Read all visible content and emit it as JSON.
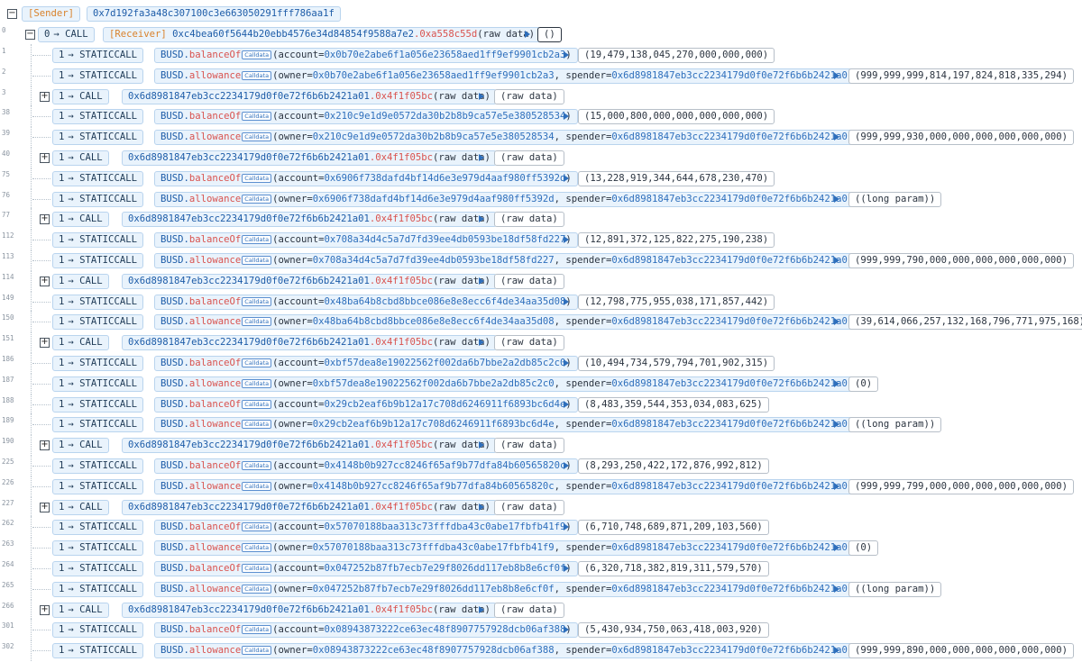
{
  "header": {
    "sender_label": "[Sender]",
    "sender_address": "0x7d192fa3a48c307100c3e663050291fff786aa1f"
  },
  "root_call": {
    "line": "0",
    "depth": "0",
    "op": "CALL",
    "receiver_label": "[Receiver]",
    "address": "0xc4bea60f5644b20ebb4576e34d84854f9588a7e2",
    "selector": ".0xa558c55d",
    "args": "(raw data)",
    "result": "()"
  },
  "calldata_badge": "Calldata",
  "rows": [
    {
      "line": "1",
      "depth": "1",
      "op": "STATICCALL",
      "contract": "BUSD.",
      "func": "balanceOf",
      "args_before": "(account=",
      "arg1": "0x0b70e2abe6f1a056e23658aed1ff9ef9901cb2a3",
      "mid": "",
      "arg2": "",
      "tail": ")",
      "result": "(19,479,138,045,270,000,000,000)"
    },
    {
      "line": "2",
      "depth": "1",
      "op": "STATICCALL",
      "contract": "BUSD.",
      "func": "allowance",
      "args_before": "(owner=",
      "arg1": "0x0b70e2abe6f1a056e23658aed1ff9ef9901cb2a3",
      "mid": ", spender=",
      "arg2": "0x6d8981847eb3cc2234179d0f0e72f6b6b2421a01",
      "tail": ")",
      "result": "(999,999,999,814,197,824,818,335,294)"
    },
    {
      "line": "3",
      "depth": "1",
      "op": "CALL",
      "collapsed": true,
      "address": "0x6d8981847eb3cc2234179d0f0e72f6b6b2421a01",
      "selector": ".0x4f1f05bc",
      "args": "(raw data)",
      "result": "(raw data)"
    },
    {
      "line": "38",
      "depth": "1",
      "op": "STATICCALL",
      "contract": "BUSD.",
      "func": "balanceOf",
      "args_before": "(account=",
      "arg1": "0x210c9e1d9e0572da30b2b8b9ca57e5e380528534",
      "mid": "",
      "arg2": "",
      "tail": ")",
      "result": "(15,000,800,000,000,000,000,000)"
    },
    {
      "line": "39",
      "depth": "1",
      "op": "STATICCALL",
      "contract": "BUSD.",
      "func": "allowance",
      "args_before": "(owner=",
      "arg1": "0x210c9e1d9e0572da30b2b8b9ca57e5e380528534",
      "mid": ", spender=",
      "arg2": "0x6d8981847eb3cc2234179d0f0e72f6b6b2421a01",
      "tail": ")",
      "result": "(999,999,930,000,000,000,000,000,000)"
    },
    {
      "line": "40",
      "depth": "1",
      "op": "CALL",
      "collapsed": true,
      "address": "0x6d8981847eb3cc2234179d0f0e72f6b6b2421a01",
      "selector": ".0x4f1f05bc",
      "args": "(raw data)",
      "result": "(raw data)"
    },
    {
      "line": "75",
      "depth": "1",
      "op": "STATICCALL",
      "contract": "BUSD.",
      "func": "balanceOf",
      "args_before": "(account=",
      "arg1": "0x6906f738dafd4bf14d6e3e979d4aaf980ff5392d",
      "mid": "",
      "arg2": "",
      "tail": ")",
      "result": "(13,228,919,344,644,678,230,470)"
    },
    {
      "line": "76",
      "depth": "1",
      "op": "STATICCALL",
      "contract": "BUSD.",
      "func": "allowance",
      "args_before": "(owner=",
      "arg1": "0x6906f738dafd4bf14d6e3e979d4aaf980ff5392d",
      "mid": ", spender=",
      "arg2": "0x6d8981847eb3cc2234179d0f0e72f6b6b2421a01",
      "tail": ")",
      "result": "((long param))"
    },
    {
      "line": "77",
      "depth": "1",
      "op": "CALL",
      "collapsed": true,
      "address": "0x6d8981847eb3cc2234179d0f0e72f6b6b2421a01",
      "selector": ".0x4f1f05bc",
      "args": "(raw data)",
      "result": "(raw data)"
    },
    {
      "line": "112",
      "depth": "1",
      "op": "STATICCALL",
      "contract": "BUSD.",
      "func": "balanceOf",
      "args_before": "(account=",
      "arg1": "0x708a34d4c5a7d7fd39ee4db0593be18df58fd227",
      "mid": "",
      "arg2": "",
      "tail": ")",
      "result": "(12,891,372,125,822,275,190,238)"
    },
    {
      "line": "113",
      "depth": "1",
      "op": "STATICCALL",
      "contract": "BUSD.",
      "func": "allowance",
      "args_before": "(owner=",
      "arg1": "0x708a34d4c5a7d7fd39ee4db0593be18df58fd227",
      "mid": ", spender=",
      "arg2": "0x6d8981847eb3cc2234179d0f0e72f6b6b2421a01",
      "tail": ")",
      "result": "(999,999,790,000,000,000,000,000,000)"
    },
    {
      "line": "114",
      "depth": "1",
      "op": "CALL",
      "collapsed": true,
      "address": "0x6d8981847eb3cc2234179d0f0e72f6b6b2421a01",
      "selector": ".0x4f1f05bc",
      "args": "(raw data)",
      "result": "(raw data)"
    },
    {
      "line": "149",
      "depth": "1",
      "op": "STATICCALL",
      "contract": "BUSD.",
      "func": "balanceOf",
      "args_before": "(account=",
      "arg1": "0x48ba64b8cbd8bbce086e8e8ecc6f4de34aa35d08",
      "mid": "",
      "arg2": "",
      "tail": ")",
      "result": "(12,798,775,955,038,171,857,442)"
    },
    {
      "line": "150",
      "depth": "1",
      "op": "STATICCALL",
      "contract": "BUSD.",
      "func": "allowance",
      "args_before": "(owner=",
      "arg1": "0x48ba64b8cbd8bbce086e8e8ecc6f4de34aa35d08",
      "mid": ", spender=",
      "arg2": "0x6d8981847eb3cc2234179d0f0e72f6b6b2421a01",
      "tail": ")",
      "result": "(39,614,066,257,132,168,796,771,975,168)"
    },
    {
      "line": "151",
      "depth": "1",
      "op": "CALL",
      "collapsed": true,
      "address": "0x6d8981847eb3cc2234179d0f0e72f6b6b2421a01",
      "selector": ".0x4f1f05bc",
      "args": "(raw data)",
      "result": "(raw data)"
    },
    {
      "line": "186",
      "depth": "1",
      "op": "STATICCALL",
      "contract": "BUSD.",
      "func": "balanceOf",
      "args_before": "(account=",
      "arg1": "0xbf57dea8e19022562f002da6b7bbe2a2db85c2c0",
      "mid": "",
      "arg2": "",
      "tail": ")",
      "result": "(10,494,734,579,794,701,902,315)"
    },
    {
      "line": "187",
      "depth": "1",
      "op": "STATICCALL",
      "contract": "BUSD.",
      "func": "allowance",
      "args_before": "(owner=",
      "arg1": "0xbf57dea8e19022562f002da6b7bbe2a2db85c2c0",
      "mid": ", spender=",
      "arg2": "0x6d8981847eb3cc2234179d0f0e72f6b6b2421a01",
      "tail": ")",
      "result": "(0)"
    },
    {
      "line": "188",
      "depth": "1",
      "op": "STATICCALL",
      "contract": "BUSD.",
      "func": "balanceOf",
      "args_before": "(account=",
      "arg1": "0x29cb2eaf6b9b12a17c708d6246911f6893bc6d4e",
      "mid": "",
      "arg2": "",
      "tail": ")",
      "result": "(8,483,359,544,353,034,083,625)"
    },
    {
      "line": "189",
      "depth": "1",
      "op": "STATICCALL",
      "contract": "BUSD.",
      "func": "allowance",
      "args_before": "(owner=",
      "arg1": "0x29cb2eaf6b9b12a17c708d6246911f6893bc6d4e",
      "mid": ", spender=",
      "arg2": "0x6d8981847eb3cc2234179d0f0e72f6b6b2421a01",
      "tail": ")",
      "result": "((long param))"
    },
    {
      "line": "190",
      "depth": "1",
      "op": "CALL",
      "collapsed": true,
      "address": "0x6d8981847eb3cc2234179d0f0e72f6b6b2421a01",
      "selector": ".0x4f1f05bc",
      "args": "(raw data)",
      "result": "(raw data)"
    },
    {
      "line": "225",
      "depth": "1",
      "op": "STATICCALL",
      "contract": "BUSD.",
      "func": "balanceOf",
      "args_before": "(account=",
      "arg1": "0x4148b0b927cc8246f65af9b77dfa84b60565820c",
      "mid": "",
      "arg2": "",
      "tail": ")",
      "result": "(8,293,250,422,172,876,992,812)"
    },
    {
      "line": "226",
      "depth": "1",
      "op": "STATICCALL",
      "contract": "BUSD.",
      "func": "allowance",
      "args_before": "(owner=",
      "arg1": "0x4148b0b927cc8246f65af9b77dfa84b60565820c",
      "mid": ", spender=",
      "arg2": "0x6d8981847eb3cc2234179d0f0e72f6b6b2421a01",
      "tail": ")",
      "result": "(999,999,799,000,000,000,000,000,000)"
    },
    {
      "line": "227",
      "depth": "1",
      "op": "CALL",
      "collapsed": true,
      "address": "0x6d8981847eb3cc2234179d0f0e72f6b6b2421a01",
      "selector": ".0x4f1f05bc",
      "args": "(raw data)",
      "result": "(raw data)"
    },
    {
      "line": "262",
      "depth": "1",
      "op": "STATICCALL",
      "contract": "BUSD.",
      "func": "balanceOf",
      "args_before": "(account=",
      "arg1": "0x57070188baa313c73fffdba43c0abe17fbfb41f9",
      "mid": "",
      "arg2": "",
      "tail": ")",
      "result": "(6,710,748,689,871,209,103,560)"
    },
    {
      "line": "263",
      "depth": "1",
      "op": "STATICCALL",
      "contract": "BUSD.",
      "func": "allowance",
      "args_before": "(owner=",
      "arg1": "0x57070188baa313c73fffdba43c0abe17fbfb41f9",
      "mid": ", spender=",
      "arg2": "0x6d8981847eb3cc2234179d0f0e72f6b6b2421a01",
      "tail": ")",
      "result": "(0)"
    },
    {
      "line": "264",
      "depth": "1",
      "op": "STATICCALL",
      "contract": "BUSD.",
      "func": "balanceOf",
      "args_before": "(account=",
      "arg1": "0x047252b87fb7ecb7e29f8026dd117eb8b8e6cf0f",
      "mid": "",
      "arg2": "",
      "tail": ")",
      "result": "(6,320,718,382,819,311,579,570)"
    },
    {
      "line": "265",
      "depth": "1",
      "op": "STATICCALL",
      "contract": "BUSD.",
      "func": "allowance",
      "args_before": "(owner=",
      "arg1": "0x047252b87fb7ecb7e29f8026dd117eb8b8e6cf0f",
      "mid": ", spender=",
      "arg2": "0x6d8981847eb3cc2234179d0f0e72f6b6b2421a01",
      "tail": ")",
      "result": "((long param))"
    },
    {
      "line": "266",
      "depth": "1",
      "op": "CALL",
      "collapsed": true,
      "address": "0x6d8981847eb3cc2234179d0f0e72f6b6b2421a01",
      "selector": ".0x4f1f05bc",
      "args": "(raw data)",
      "result": "(raw data)"
    },
    {
      "line": "301",
      "depth": "1",
      "op": "STATICCALL",
      "contract": "BUSD.",
      "func": "balanceOf",
      "args_before": "(account=",
      "arg1": "0x08943873222ce63ec48f8907757928dcb06af388",
      "mid": "",
      "arg2": "",
      "tail": ")",
      "result": "(5,430,934,750,063,418,003,920)"
    },
    {
      "line": "302",
      "depth": "1",
      "op": "STATICCALL",
      "contract": "BUSD.",
      "func": "allowance",
      "args_before": "(owner=",
      "arg1": "0x08943873222ce63ec48f8907757928dcb06af388",
      "mid": ", spender=",
      "arg2": "0x6d8981847eb3cc2234179d0f0e72f6b6b2421a01",
      "tail": ")",
      "result": "(999,999,890,000,000,000,000,000,000)"
    }
  ]
}
